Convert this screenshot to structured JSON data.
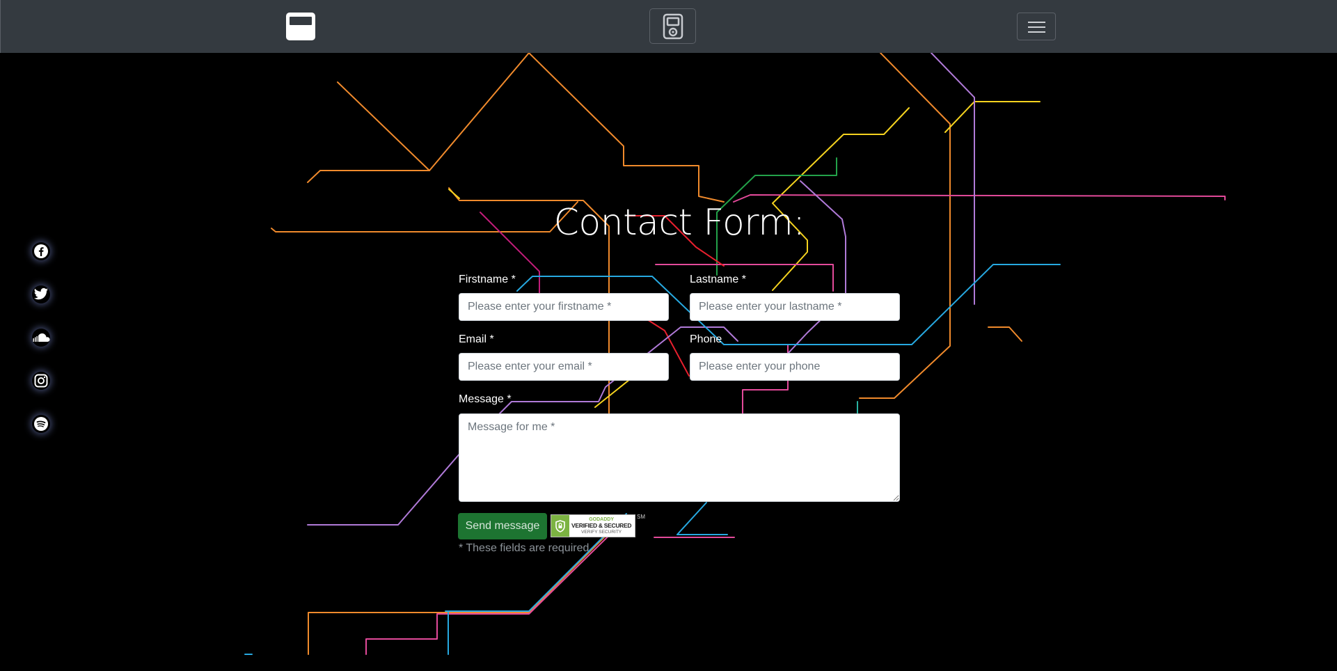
{
  "navbar": {
    "logo_icon": "album-cover-icon",
    "center_icon": "ipod-icon",
    "menu_icon": "hamburger-menu-icon"
  },
  "social": [
    {
      "name": "facebook-icon"
    },
    {
      "name": "twitter-icon"
    },
    {
      "name": "soundcloud-icon"
    },
    {
      "name": "instagram-icon"
    },
    {
      "name": "spotify-icon"
    }
  ],
  "form": {
    "title": "Contact Form:",
    "firstname_label": "Firstname *",
    "firstname_placeholder": "Please enter your firstname *",
    "lastname_label": "Lastname *",
    "lastname_placeholder": "Please enter your lastname *",
    "email_label": "Email *",
    "email_placeholder": "Please enter your email *",
    "phone_label": "Phone",
    "phone_placeholder": "Please enter your phone",
    "message_label": "Message *",
    "message_placeholder": "Message for me *",
    "send_label": "Send message",
    "required_note": "* These fields are required."
  },
  "seal": {
    "brand": "GODADDY",
    "main": "VERIFIED & SECURED",
    "sub": "VERIFY SECURITY",
    "tag": "SM"
  },
  "colors": {
    "navbar": "#343a40",
    "background": "#000000",
    "send_button": "#1d7431"
  }
}
